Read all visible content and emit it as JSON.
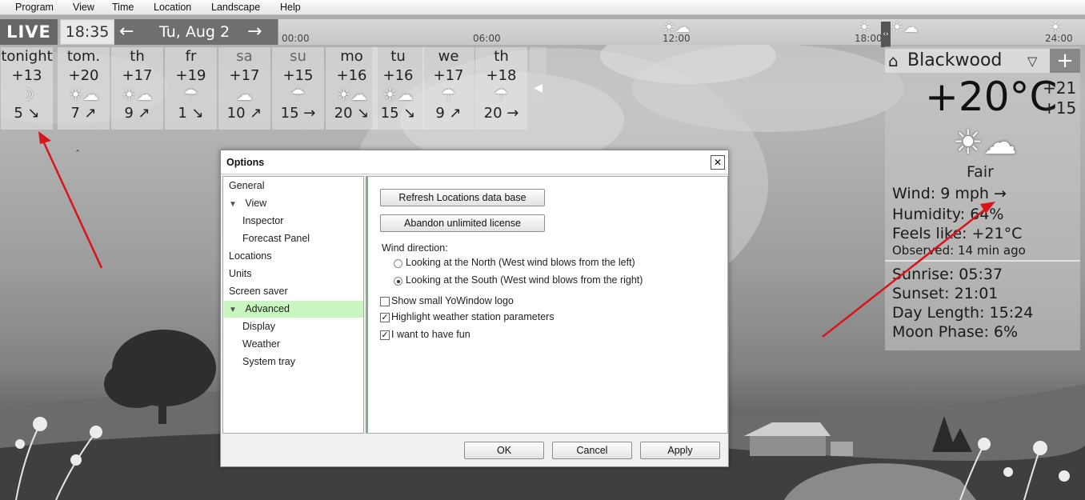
{
  "menu": [
    "Program",
    "View",
    "Time",
    "Location",
    "Landscape",
    "Help"
  ],
  "timebar": {
    "live": "LIVE",
    "time": "18:35",
    "prev_arrow": "←",
    "date": "Tu, Aug 2",
    "next_arrow": "→",
    "ticks": [
      "00:00",
      "06:00",
      "12:00",
      "18:00",
      "24:00"
    ],
    "divider_glyph": "‹›"
  },
  "forecast": [
    {
      "day": "tonight",
      "temp": "+13",
      "icon": "moon-icon",
      "glyph": "☽",
      "wind": "5 ↘"
    },
    {
      "day": "tom.",
      "temp": "+20",
      "icon": "partly-cloudy-icon",
      "glyph": "☀☁",
      "wind": "7 ↗"
    },
    {
      "day": "th",
      "temp": "+17",
      "icon": "partly-cloudy-icon",
      "glyph": "☀☁",
      "wind": "9 ↗"
    },
    {
      "day": "fr",
      "temp": "+19",
      "icon": "rain-icon",
      "glyph": "☂",
      "wind": "1 ↘"
    },
    {
      "day": "sa",
      "temp": "+17",
      "icon": "cloud-icon",
      "glyph": "☁",
      "wind": "10 ↗"
    },
    {
      "day": "su",
      "temp": "+15",
      "icon": "rain-icon",
      "glyph": "☂",
      "wind": "15 →"
    },
    {
      "day": "mo",
      "temp": "+16",
      "icon": "partly-cloudy-icon",
      "glyph": "☀☁",
      "wind": "20 ↘"
    },
    {
      "day": "tu",
      "temp": "+16",
      "icon": "partly-cloudy-icon",
      "glyph": "☀☁",
      "wind": "15 ↘"
    },
    {
      "day": "we",
      "temp": "+17",
      "icon": "rain-icon",
      "glyph": "☂",
      "wind": "9 ↗"
    },
    {
      "day": "th",
      "temp": "+18",
      "icon": "rain-icon",
      "glyph": "☂",
      "wind": "20 →"
    }
  ],
  "collapse_glyph": "◀",
  "caret_glyph": "ˆ",
  "current": {
    "location": "Blackwood",
    "dropdown_glyph": "▽",
    "add_glyph": "+",
    "home_glyph": "⌂",
    "temp": "+20°C",
    "high": "+21",
    "low": "+15",
    "icon_glyph": "☀☁",
    "condition": "Fair",
    "wind_label": "Wind:",
    "wind_value": "9 mph  →",
    "humidity_label": "Humidity:",
    "humidity_value": "64%",
    "feels_label": "Feels like:",
    "feels_value": "+21°C",
    "observed_label": "Observed:",
    "observed_value": "14 min ago",
    "sunrise_label": "Sunrise:",
    "sunrise_value": "05:37",
    "sunset_label": "Sunset:",
    "sunset_value": "21:01",
    "daylength_label": "Day Length:",
    "daylength_value": "15:24",
    "moon_label": "Moon Phase:",
    "moon_value": "6%"
  },
  "dialog": {
    "title": "Options",
    "close_glyph": "✕",
    "tree": [
      {
        "label": "General",
        "level": 0,
        "expander": ""
      },
      {
        "label": "View",
        "level": 0,
        "expander": "▼"
      },
      {
        "label": "Inspector",
        "level": 1,
        "expander": ""
      },
      {
        "label": "Forecast Panel",
        "level": 1,
        "expander": ""
      },
      {
        "label": "Locations",
        "level": 0,
        "expander": ""
      },
      {
        "label": "Units",
        "level": 0,
        "expander": ""
      },
      {
        "label": "Screen saver",
        "level": 0,
        "expander": ""
      },
      {
        "label": "Advanced",
        "level": 0,
        "expander": "▼",
        "selected": true
      },
      {
        "label": "Display",
        "level": 1,
        "expander": ""
      },
      {
        "label": "Weather",
        "level": 1,
        "expander": ""
      },
      {
        "label": "System tray",
        "level": 1,
        "expander": ""
      }
    ],
    "refresh_button": "Refresh Locations data base",
    "abandon_button": "Abandon unlimited license",
    "wind_direction_label": "Wind direction:",
    "radio_north": "Looking at the North (West wind blows from the left)",
    "radio_south": "Looking at the South (West wind blows from the right)",
    "radio_selected": "south",
    "chk_logo": "Show small YoWindow logo",
    "chk_logo_checked": false,
    "chk_highlight": "Highlight weather station parameters",
    "chk_highlight_checked": true,
    "chk_fun": "I want to have fun",
    "chk_fun_checked": true,
    "ok": "OK",
    "cancel": "Cancel",
    "apply": "Apply"
  },
  "colors": {
    "annotation_arrow": "#d9141b",
    "tree_selected": "#c8f5c0",
    "live_bg": "#666666"
  }
}
